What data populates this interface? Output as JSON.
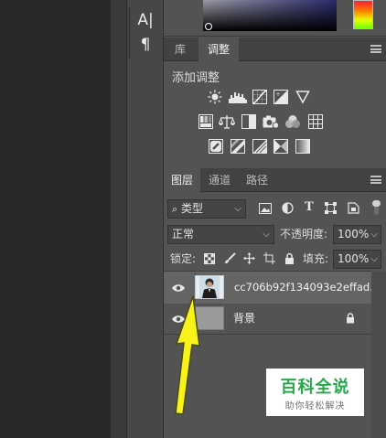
{
  "tools": [
    {
      "name": "type-tool",
      "glyph": "A|"
    },
    {
      "name": "paragraph-tool",
      "glyph": "¶"
    }
  ],
  "adjustments_panel": {
    "tabs": [
      "库",
      "调整"
    ],
    "active_tab": "调整",
    "title": "添加调整",
    "icon_rows": [
      [
        "brightness-icon",
        "levels-icon",
        "curves-icon",
        "exposure-icon",
        "vibrance-icon"
      ],
      [
        "hue-saturation-icon",
        "color-balance-icon",
        "black-white-icon",
        "photo-filter-icon",
        "channel-mixer-icon",
        "color-lookup-icon"
      ],
      [
        "invert-icon",
        "posterize-icon",
        "threshold-icon",
        "selective-color-icon",
        "gradient-map-icon"
      ]
    ]
  },
  "layers_panel": {
    "tabs": [
      "图层",
      "通道",
      "路径"
    ],
    "active_tab": "图层",
    "filter_kind": "类型",
    "filter_icons": [
      "image-filter-icon",
      "adjustment-filter-icon",
      "text-filter-icon",
      "shape-filter-icon",
      "smart-object-filter-icon"
    ],
    "blend_mode": "正常",
    "opacity_label": "不透明度:",
    "opacity_value": "100%",
    "lock_label": "锁定:",
    "lock_icons": [
      "lock-transparent-icon",
      "lock-paint-icon",
      "lock-move-icon",
      "lock-artboard-icon",
      "lock-all-icon"
    ],
    "fill_label": "填充:",
    "fill_value": "100%",
    "layers": [
      {
        "name": "cc706b92f134093e2effad...",
        "selected": true,
        "locked": false
      },
      {
        "name": "背景",
        "selected": false,
        "locked": true
      }
    ]
  },
  "watermark": {
    "title": "百科全说",
    "subtitle": "助你轻松解决"
  },
  "colors": {
    "annotation_arrow": "#f7f21a",
    "brand_green": "#27a84a"
  }
}
